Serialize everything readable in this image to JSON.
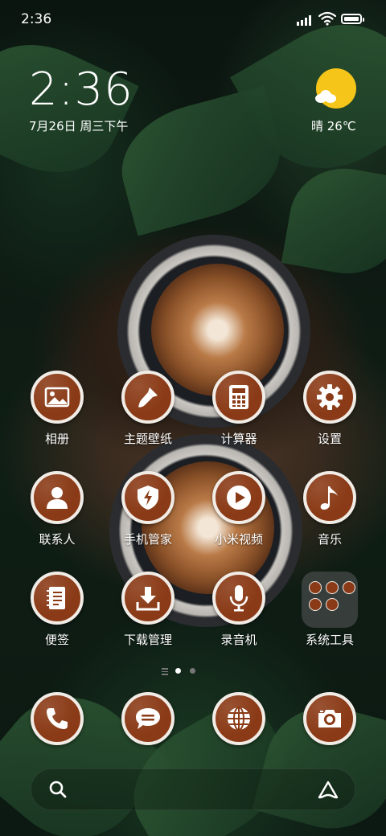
{
  "status_bar": {
    "time": "2:36"
  },
  "widget": {
    "clock": "2:36",
    "date": "7月26日 周三下午",
    "weather": "晴 26℃"
  },
  "apps": {
    "row1": [
      {
        "label": "相册",
        "icon": "gallery-icon"
      },
      {
        "label": "主题壁纸",
        "icon": "brush-icon"
      },
      {
        "label": "计算器",
        "icon": "calculator-icon"
      },
      {
        "label": "设置",
        "icon": "gear-icon"
      }
    ],
    "row2": [
      {
        "label": "联系人",
        "icon": "person-icon"
      },
      {
        "label": "手机管家",
        "icon": "shield-icon"
      },
      {
        "label": "小米视频",
        "icon": "play-icon"
      },
      {
        "label": "音乐",
        "icon": "music-note-icon"
      }
    ],
    "row3": [
      {
        "label": "便签",
        "icon": "notes-icon"
      },
      {
        "label": "下载管理",
        "icon": "download-icon"
      },
      {
        "label": "录音机",
        "icon": "microphone-icon"
      },
      {
        "label": "系统工具",
        "icon": "folder-icon"
      }
    ]
  },
  "dock": [
    {
      "icon": "phone-icon"
    },
    {
      "icon": "message-icon"
    },
    {
      "icon": "browser-globe-icon"
    },
    {
      "icon": "camera-icon"
    }
  ],
  "page_indicator": {
    "pages": 2,
    "current": 1
  },
  "colors": {
    "icon_fill": "#8a3a16",
    "icon_border": "#f1ece6",
    "sun": "#f6c519"
  }
}
